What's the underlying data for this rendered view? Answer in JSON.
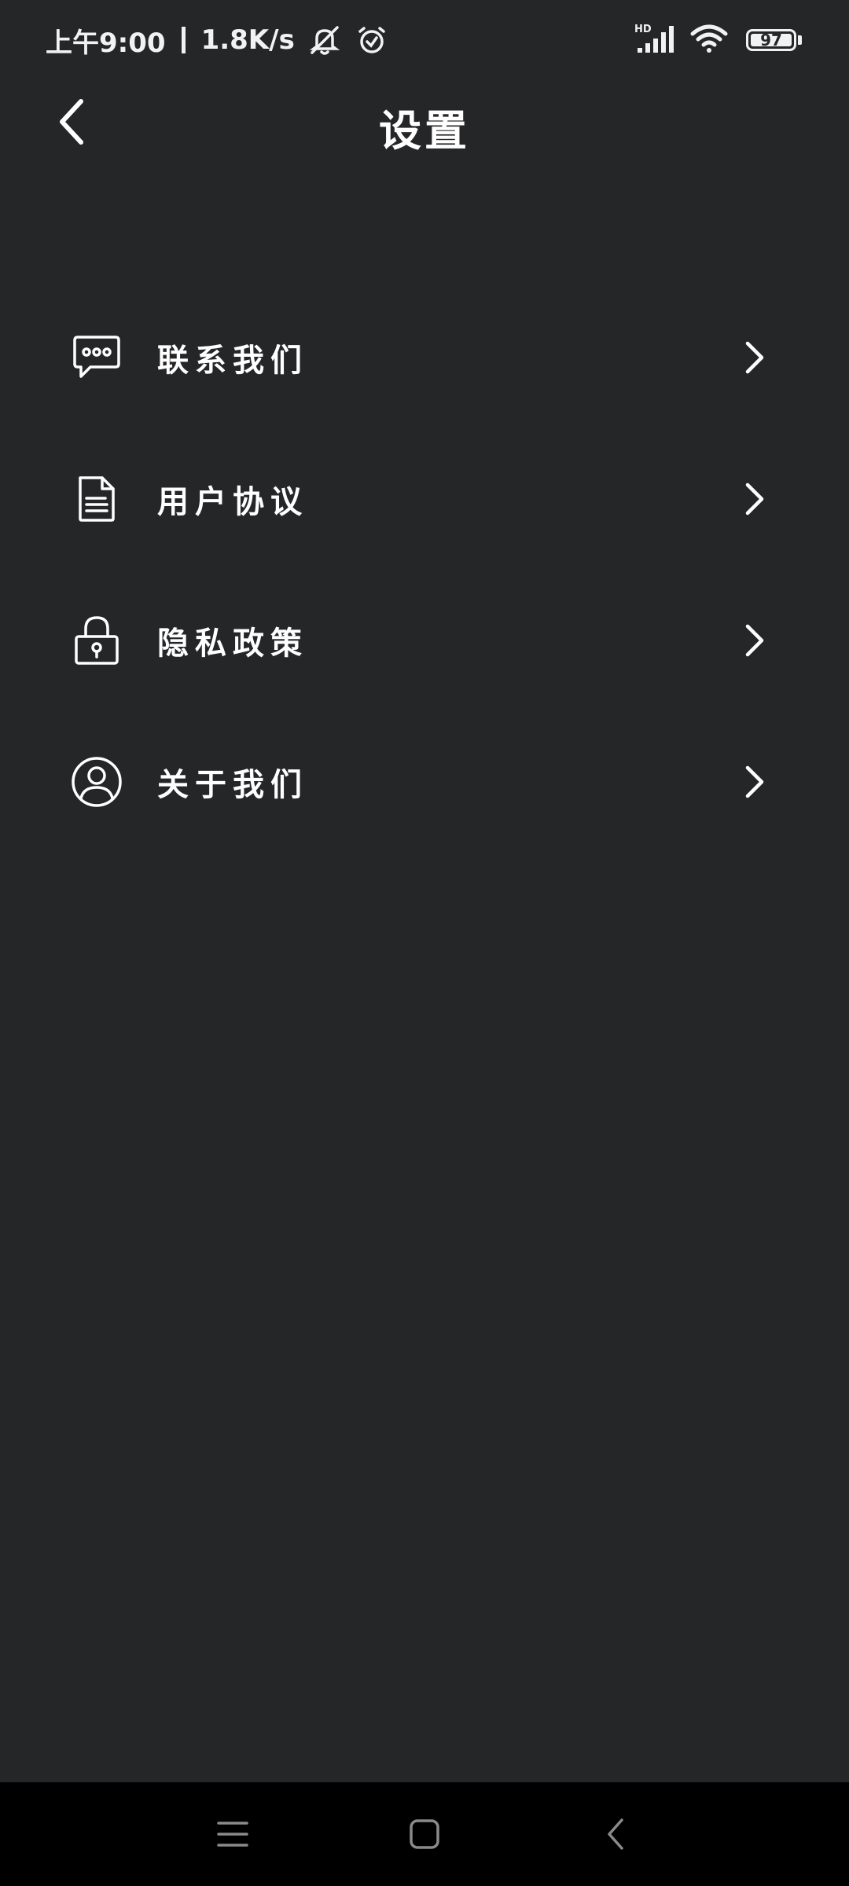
{
  "status_bar": {
    "time": "上午9:00",
    "net_speed": "1.8K/s",
    "battery_level": "97",
    "icons": [
      "mute-icon",
      "alarm-icon",
      "hd-signal-icon",
      "wifi-icon",
      "battery-icon"
    ]
  },
  "header": {
    "title": "设置",
    "back_icon": "chevron-left-icon"
  },
  "menu": {
    "items": [
      {
        "label": "联系我们",
        "icon": "chat-bubble-icon"
      },
      {
        "label": "用户协议",
        "icon": "document-icon"
      },
      {
        "label": "隐私政策",
        "icon": "lock-icon"
      },
      {
        "label": "关于我们",
        "icon": "user-circle-icon"
      }
    ]
  },
  "nav_bar": {
    "icons": [
      "menu-icon",
      "home-icon",
      "back-icon"
    ]
  },
  "colors": {
    "background": "#252628",
    "foreground": "#ffffff",
    "nav_background": "#000000"
  }
}
